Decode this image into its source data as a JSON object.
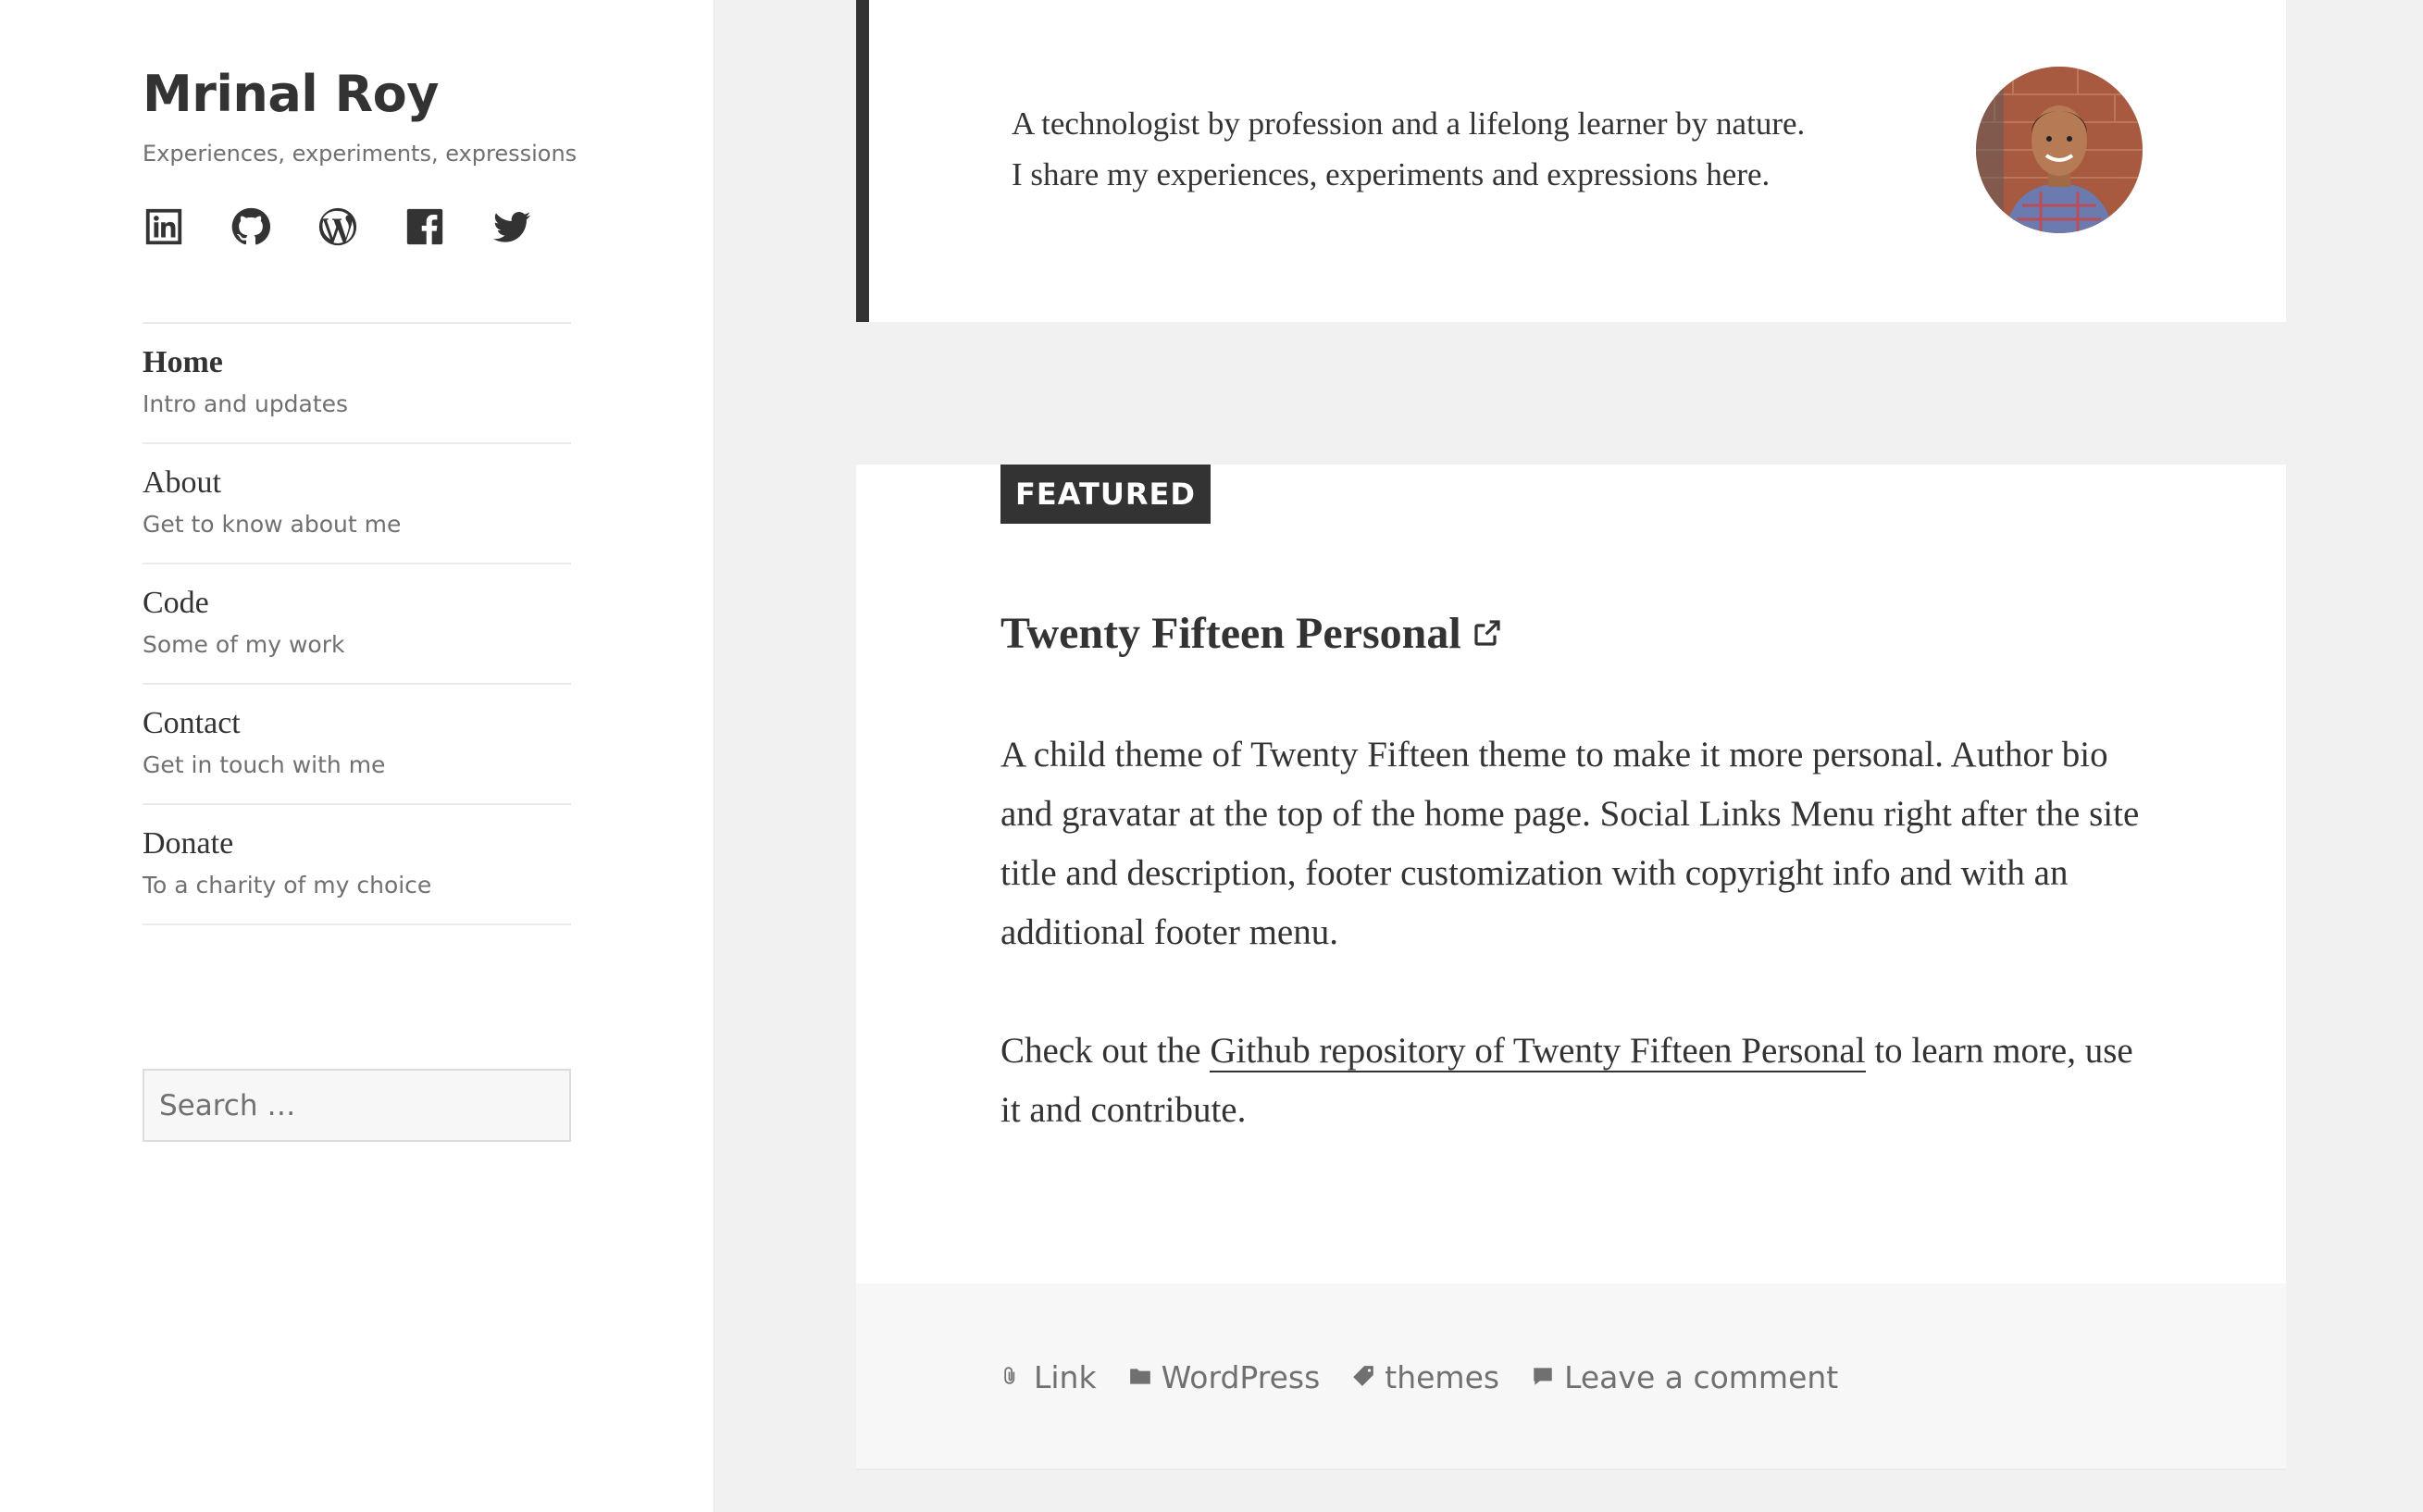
{
  "site": {
    "title": "Mrinal Roy",
    "description": "Experiences, experiments, expressions"
  },
  "social_icons": [
    "linkedin-icon",
    "github-icon",
    "wordpress-icon",
    "facebook-icon",
    "twitter-icon"
  ],
  "menu": {
    "items": [
      {
        "label": "Home",
        "description": "Intro and updates",
        "current": true
      },
      {
        "label": "About",
        "description": "Get to know about me",
        "current": false
      },
      {
        "label": "Code",
        "description": "Some of my work",
        "current": false
      },
      {
        "label": "Contact",
        "description": "Get in touch with me",
        "current": false
      },
      {
        "label": "Donate",
        "description": "To a charity of my choice",
        "current": false
      }
    ]
  },
  "search": {
    "placeholder": "Search …"
  },
  "bio": {
    "line1": "A technologist by profession and a lifelong learner by nature.",
    "line2": "I share my experiences, experiments and expressions here."
  },
  "post": {
    "badge": "FEATURED",
    "title": "Twenty Fifteen Personal",
    "paragraph1": "A child theme of Twenty Fifteen theme to make it more personal. Author bio and gravatar at the top of the home page. Social Links Menu right after the site title and description, footer customization with copyright info and with an additional footer menu.",
    "paragraph2_before": "Check out the ",
    "paragraph2_link": "Github repository of Twenty Fifteen Personal",
    "paragraph2_after": " to learn more, use it and contribute.",
    "meta": {
      "format": "Link",
      "category": "WordPress",
      "tag": "themes",
      "comments": "Leave a comment"
    }
  },
  "colors": {
    "page_background": "#f1f1f1",
    "text": "#333333",
    "secondary_text": "#707070",
    "bio_border": "#333333",
    "badge_background": "#333333"
  }
}
